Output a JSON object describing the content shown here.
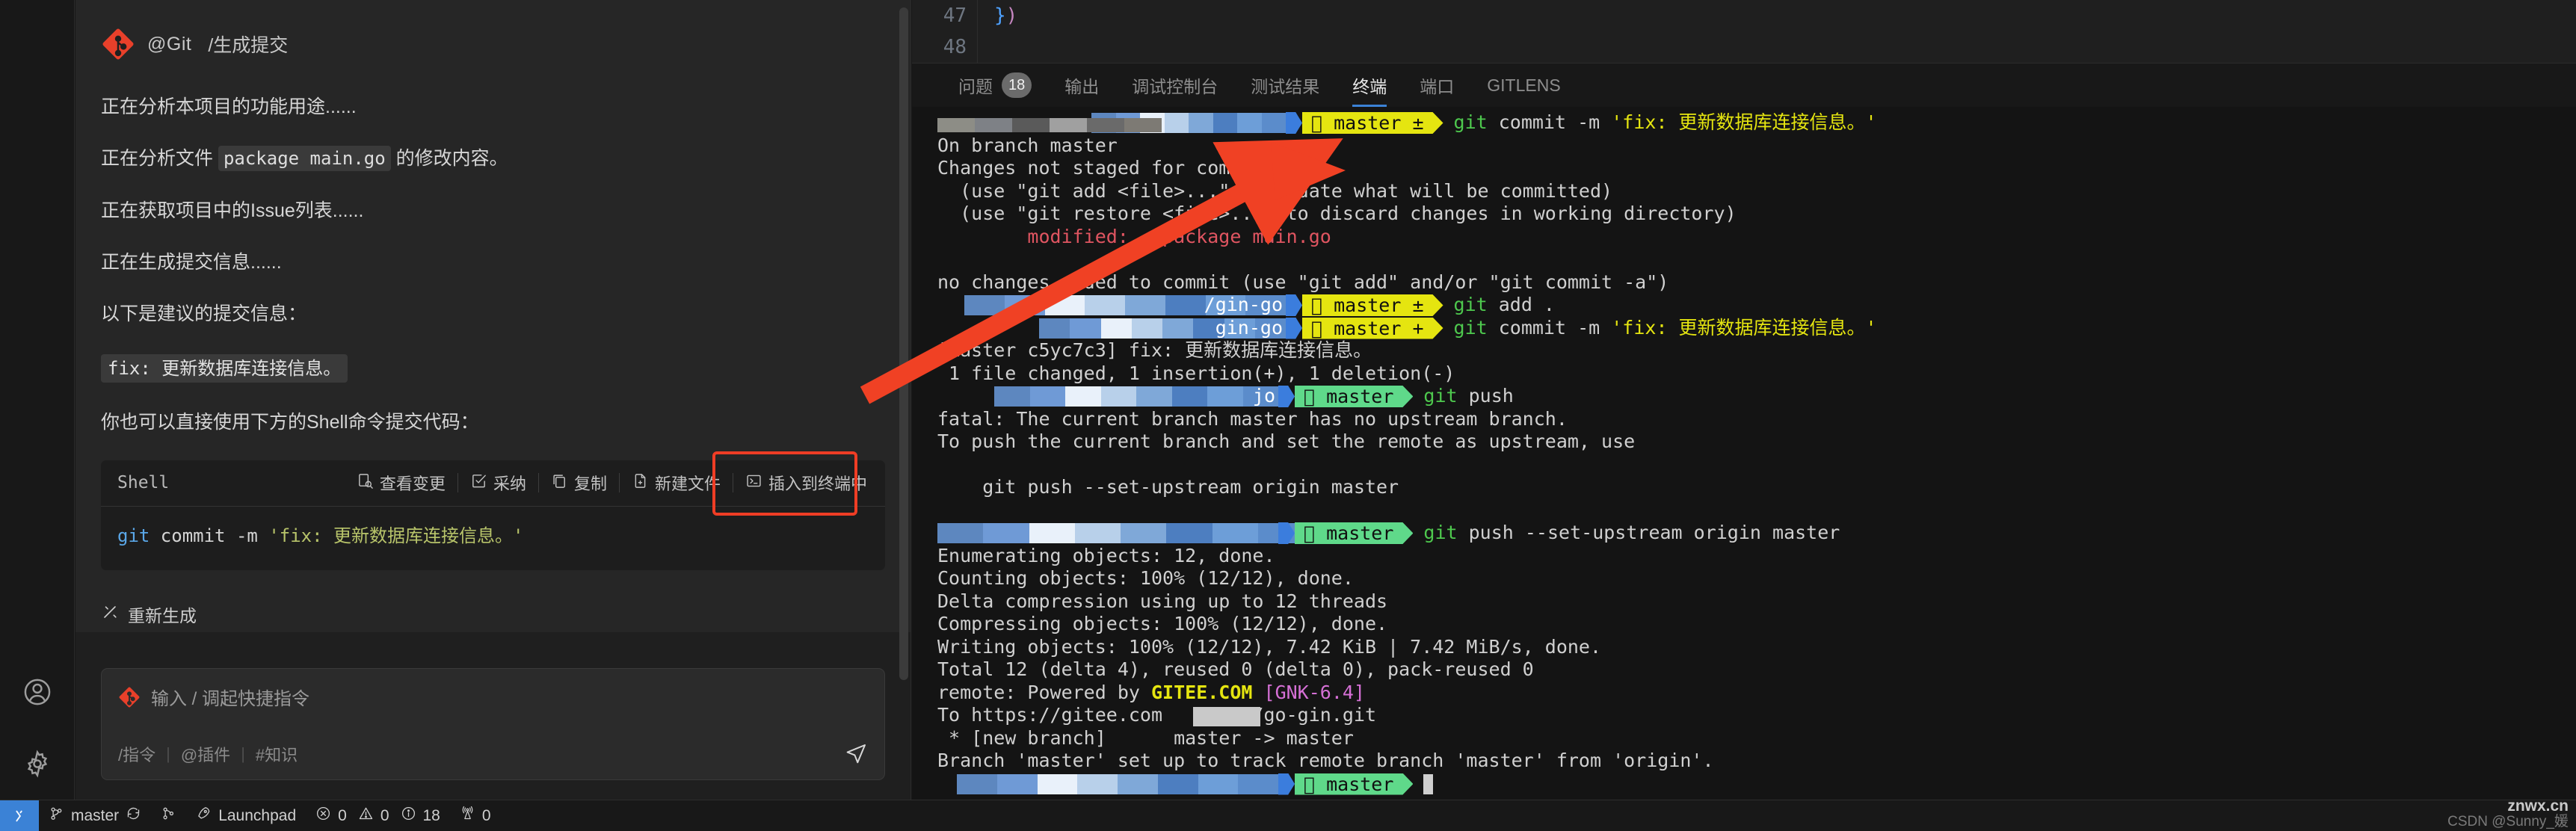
{
  "rail": {
    "items": [
      {
        "name": "account-icon",
        "label": "账户"
      },
      {
        "name": "settings-gear-icon",
        "label": "管理"
      }
    ]
  },
  "chat": {
    "agent": {
      "logo": "git-logo-icon",
      "handle": "@Git",
      "command": "/生成提交"
    },
    "messages": [
      "正在分析本项目的功能用途......",
      "正在获取项目中的Issue列表......",
      "正在生成提交信息......",
      "以下是建议的提交信息："
    ],
    "file_line": {
      "prefix": "正在分析文件 ",
      "code": "package main.go",
      "suffix": " 的修改内容。"
    },
    "commit_message": "fix: 更新数据库连接信息。",
    "hint": "你也可以直接使用下方的Shell命令提交代码：",
    "codeblock": {
      "lang": "Shell",
      "actions": [
        {
          "label": "查看变更",
          "icon": "view-diff-icon"
        },
        {
          "label": "采纳",
          "icon": "accept-check-icon"
        },
        {
          "label": "复制",
          "icon": "copy-icon"
        },
        {
          "label": "新建文件",
          "icon": "new-file-icon"
        },
        {
          "label": "插入到终端中",
          "icon": "insert-terminal-icon",
          "highlighted": true
        }
      ],
      "code": {
        "kw": "git",
        "plain": " commit -m ",
        "str": "'fix: 更新数据库连接信息。'"
      }
    },
    "regenerate": "重新生成",
    "input": {
      "placeholder": "输入 / 调起快捷指令",
      "hints": [
        "/指令",
        "@插件",
        "#知识"
      ],
      "send_icon": "send-icon"
    }
  },
  "editor": {
    "line_numbers": [
      "47",
      "48"
    ],
    "code": "})"
  },
  "panel": {
    "tabs": [
      {
        "label": "问题",
        "badge": "18",
        "active": false
      },
      {
        "label": "输出",
        "badge": null,
        "active": false
      },
      {
        "label": "调试控制台",
        "badge": null,
        "active": false
      },
      {
        "label": "测试结果",
        "badge": null,
        "active": false
      },
      {
        "label": "终端",
        "badge": null,
        "active": true
      },
      {
        "label": "端口",
        "badge": null,
        "active": false
      },
      {
        "label": "GITLENS",
        "badge": null,
        "active": false
      }
    ]
  },
  "terminal": {
    "prompts": {
      "yellow_mod": {
        "branch": "master ±",
        "bg": "#e5e510"
      },
      "yellow_add": {
        "branch": "master +",
        "bg": "#e5e510"
      },
      "green": {
        "branch": "master",
        "bg": "#5fd98a"
      }
    },
    "lines": [
      {
        "type": "prompt",
        "style": "yellow_mod",
        "path": "",
        "cmd_kw": "git",
        "cmd": " commit -m ",
        "str": "'fix: 更新数据库连接信息。'",
        "mosaic_w": 260
      },
      {
        "type": "out",
        "text": "On branch master"
      },
      {
        "type": "out",
        "text": "Changes not staged for commit:"
      },
      {
        "type": "out",
        "text": "  (use \"git add <file>...\" to update what will be committed)"
      },
      {
        "type": "out",
        "text": "  (use \"git restore <file>...\" to discard changes in working directory)"
      },
      {
        "type": "red",
        "text": "        modified:   package main.go"
      },
      {
        "type": "blank"
      },
      {
        "type": "out",
        "text": "no changes added to commit (use \"git add\" and/or \"git commit -a\")"
      },
      {
        "type": "prompt",
        "style": "yellow_mod",
        "path": "/gin-go",
        "cmd_kw": "git",
        "cmd": " add .",
        "str": "",
        "mosaic_w": 430
      },
      {
        "type": "prompt",
        "style": "yellow_add",
        "path": "gin-go",
        "cmd_kw": "git",
        "cmd": " commit -m ",
        "str": "'fix: 更新数据库连接信息。'",
        "mosaic_w": 330
      },
      {
        "type": "out",
        "text": "[master c5yc7c3] fix: 更新数据库连接信息。"
      },
      {
        "type": "out",
        "text": " 1 file changed, 1 insertion(+), 1 deletion(-)"
      },
      {
        "type": "prompt",
        "style": "green",
        "path": "jo",
        "cmd_kw": "git",
        "cmd": " push",
        "str": "",
        "mosaic_w": 380
      },
      {
        "type": "out",
        "text": "fatal: The current branch master has no upstream branch."
      },
      {
        "type": "out",
        "text": "To push the current branch and set the remote as upstream, use"
      },
      {
        "type": "blank"
      },
      {
        "type": "out",
        "text": "    git push --set-upstream origin master"
      },
      {
        "type": "blank"
      },
      {
        "type": "prompt",
        "style": "green",
        "path": "",
        "cmd_kw": "git",
        "cmd": " push --set-upstream origin master",
        "str": "",
        "mosaic_w": 490
      },
      {
        "type": "out",
        "text": "Enumerating objects: 12, done."
      },
      {
        "type": "out",
        "text": "Counting objects: 100% (12/12), done."
      },
      {
        "type": "out",
        "text": "Delta compression using up to 12 threads"
      },
      {
        "type": "out",
        "text": "Compressing objects: 100% (12/12), done."
      },
      {
        "type": "out",
        "text": "Writing objects: 100% (12/12), 7.42 KiB | 7.42 MiB/s, done."
      },
      {
        "type": "out",
        "text": "Total 12 (delta 4), reused 0 (delta 0), pack-reused 0"
      },
      {
        "type": "remote",
        "prefix": "remote: Powered by ",
        "site": "GITEE.COM",
        "code": "[GNK-6.4]"
      },
      {
        "type": "out",
        "text": "To https://gitee.com        /go-gin.git"
      },
      {
        "type": "out",
        "text": " * [new branch]      master -> master"
      },
      {
        "type": "out",
        "text": "Branch 'master' set up to track remote branch 'master' from 'origin'."
      },
      {
        "type": "prompt",
        "style": "green",
        "path": "",
        "cmd_kw": "",
        "cmd": "",
        "str": "",
        "mosaic_w": 430,
        "cursor": true
      }
    ]
  },
  "statusbar": {
    "items": [
      {
        "name": "remote-indicator",
        "label": "",
        "icon": "remote-icon"
      },
      {
        "name": "branch",
        "label": "master",
        "icon": "source-control-icon"
      },
      {
        "name": "sync",
        "label": "",
        "icon": "sync-icon"
      },
      {
        "name": "git-graph",
        "label": "",
        "icon": "git-graph-icon"
      },
      {
        "name": "launchpad",
        "label": "Launchpad",
        "icon": "rocket-icon"
      },
      {
        "name": "errors",
        "label": "0",
        "icon": "error-icon"
      },
      {
        "name": "warnings",
        "label": "0",
        "icon": "warning-icon"
      },
      {
        "name": "infos",
        "label": "18",
        "icon": "info-icon"
      },
      {
        "name": "radio-tower",
        "label": "0",
        "icon": "broadcast-icon"
      }
    ]
  },
  "watermark": {
    "line1": "znwx.cn",
    "line2": "CSDN @Sunny_媛"
  }
}
